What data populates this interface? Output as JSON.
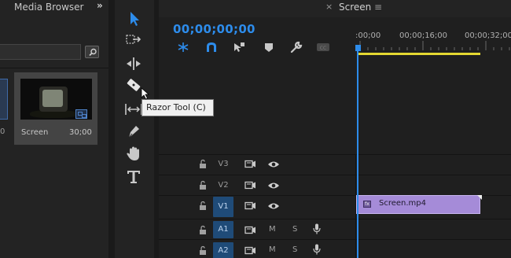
{
  "media_browser": {
    "title": "Media Browser",
    "expand_label": "»",
    "left_partial_label": "0",
    "item": {
      "name": "Screen",
      "duration": "30;00"
    }
  },
  "tooltip": {
    "text": "Razor Tool (C)"
  },
  "timeline": {
    "close_label": "×",
    "tab_title": "Screen",
    "menu_label": "≡",
    "timecode": "00;00;00;00",
    "ruler_labels": [
      ":00;00",
      "00;00;16;00",
      "00;00;32;00"
    ],
    "tracks": [
      {
        "name": "V3",
        "active": false
      },
      {
        "name": "V2",
        "active": false
      },
      {
        "name": "V1",
        "active": true
      },
      {
        "name": "A1",
        "active": true,
        "mute": "M",
        "solo": "S"
      },
      {
        "name": "A2",
        "active": true,
        "mute": "M",
        "solo": "S"
      }
    ],
    "clip": {
      "name": "Screen.mp4",
      "fx": "fx"
    }
  },
  "colors": {
    "accent": "#2d8ceb",
    "work_area": "#e4d832",
    "clip": "#a58bd8",
    "track_active": "#1f4b78"
  },
  "icons": {
    "tools": [
      "selection-tool-icon",
      "track-select-icon",
      "ripple-edit-icon",
      "razor-tool-icon",
      "slip-tool-icon",
      "pen-tool-icon",
      "hand-tool-icon",
      "type-tool-icon"
    ],
    "timeline_tools": [
      "snap-nest-icon",
      "snap-magnet-icon",
      "linked-selection-icon",
      "add-marker-icon",
      "settings-wrench-icon",
      "captions-icon"
    ]
  }
}
